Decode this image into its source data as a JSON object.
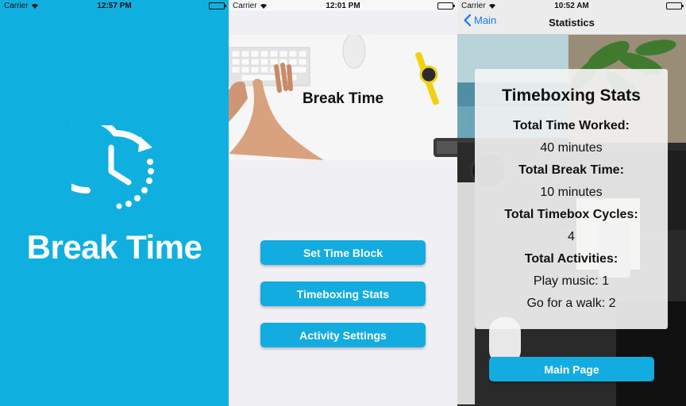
{
  "screens": [
    {
      "status": {
        "carrier": "Carrier",
        "time": "12:57 PM"
      },
      "app_title": "Break Time",
      "brand_color": "#0fb0e0",
      "logo_icon": "clock-refresh-icon"
    },
    {
      "status": {
        "carrier": "Carrier",
        "time": "12:01 PM"
      },
      "hero_title": "Break Time",
      "buttons": [
        "Set Time Block",
        "Timeboxing Stats",
        "Activity Settings"
      ],
      "button_color": "#12ace0"
    },
    {
      "status": {
        "carrier": "Carrier",
        "time": "10:52 AM"
      },
      "nav": {
        "back_label": "Main",
        "title": "Statistics"
      },
      "stats": {
        "title": "Timeboxing Stats",
        "items": [
          {
            "label": "Total Time Worked:",
            "value": "40 minutes"
          },
          {
            "label": "Total Break Time:",
            "value": "10 minutes"
          },
          {
            "label": "Total Timebox Cycles:",
            "value": "4"
          }
        ],
        "activities_label": "Total Activities:",
        "activities": [
          "Play music: 1",
          "Go for a walk: 2"
        ]
      },
      "main_button": "Main Page"
    }
  ]
}
